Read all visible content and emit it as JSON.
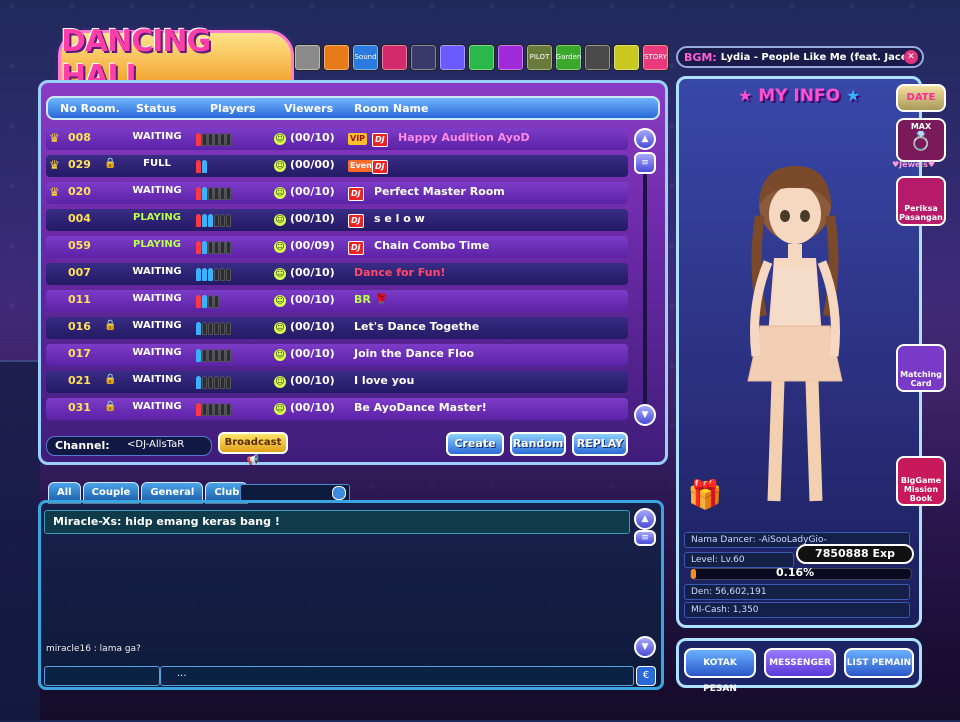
{
  "logo": {
    "text": "DANCING HALL"
  },
  "top_icons": [
    {
      "name": "card-icon",
      "label": "",
      "color": "#8a8a8a"
    },
    {
      "name": "shop-icon",
      "label": "",
      "color": "#e87a1a"
    },
    {
      "name": "sound-icon",
      "label": "Sound",
      "color": "#2a7ae0"
    },
    {
      "name": "bag-icon",
      "label": "",
      "color": "#d22a6a"
    },
    {
      "name": "ghost-icon",
      "label": "",
      "color": "#3a3a6a"
    },
    {
      "name": "world-icon",
      "label": "",
      "color": "#6a5aff"
    },
    {
      "name": "star-icon",
      "label": "",
      "color": "#2ab84a"
    },
    {
      "name": "gift-icon",
      "label": "",
      "color": "#a02ad8"
    },
    {
      "name": "pilot-icon",
      "label": "PILOT",
      "color": "#6a7a3a"
    },
    {
      "name": "garden-icon",
      "label": "Garden",
      "color": "#3aa82a"
    },
    {
      "name": "album-icon",
      "label": "",
      "color": "#4a4a4a"
    },
    {
      "name": "note-icon",
      "label": "",
      "color": "#c8c820"
    },
    {
      "name": "story-icon",
      "label": "STORY",
      "color": "#e83a7a"
    }
  ],
  "bgm": {
    "label": "BGM:",
    "song": "Lydia - People Like Me (feat. Jace)"
  },
  "room_list": {
    "headers": {
      "no": "No Room.",
      "status": "Status",
      "players": "Players",
      "viewers": "Viewers",
      "name": "Room Name"
    },
    "rows": [
      {
        "crown": "♛",
        "no": "008",
        "lock": "",
        "status": "WAITING",
        "st": "waiting",
        "players": "r,e,e,e,e,e",
        "viewers": "(00/10)",
        "badges": [
          "VIP",
          "DJ"
        ],
        "name": "Happy Audition AyoD",
        "name_color": "#ff8ae8"
      },
      {
        "crown": "♛",
        "no": "029",
        "lock": "🔒",
        "status": "FULL",
        "st": "full",
        "players": "r,bl",
        "viewers": "(00/00)",
        "badges": [
          "Event",
          "DJ"
        ],
        "name": "",
        "name_color": "#fff"
      },
      {
        "crown": "♛",
        "no": "020",
        "lock": "",
        "status": "WAITING",
        "st": "waiting",
        "players": "r,bl,e,e,e,e",
        "viewers": "(00/10)",
        "badges": [
          "DJ"
        ],
        "name": "Perfect Master Room",
        "name_color": "#ffffff"
      },
      {
        "crown": "",
        "no": "004",
        "lock": "",
        "status": "PLAYING",
        "st": "playing",
        "players": "r,bl,bl,e,e,e",
        "viewers": "(00/10)",
        "badges": [
          "DJ"
        ],
        "name": "s e l o w",
        "name_color": "#ffffff"
      },
      {
        "crown": "",
        "no": "059",
        "lock": "",
        "status": "PLAYING",
        "st": "playing",
        "players": "r,bl,e,e,e,e",
        "viewers": "(00/09)",
        "badges": [
          "DJ"
        ],
        "name": "Chain Combo Time",
        "name_color": "#ffffff"
      },
      {
        "crown": "",
        "no": "007",
        "lock": "",
        "status": "WAITING",
        "st": "waiting",
        "players": "bl,bl,bl,e,e,e",
        "viewers": "(00/10)",
        "badges": [],
        "name": "Dance for Fun!",
        "name_color": "#ff4a6a"
      },
      {
        "crown": "",
        "no": "011",
        "lock": "",
        "status": "WAITING",
        "st": "waiting",
        "players": "r,bl,e,e",
        "viewers": "(00/10)",
        "badges": [],
        "name": "BR 🌹",
        "name_color": "#b8ff4a"
      },
      {
        "crown": "",
        "no": "016",
        "lock": "🔒",
        "status": "WAITING",
        "st": "waiting",
        "players": "bl,e,e,e,e,e",
        "viewers": "(00/10)",
        "badges": [],
        "name": "Let's Dance Togethe",
        "name_color": "#ffffff"
      },
      {
        "crown": "",
        "no": "017",
        "lock": "",
        "status": "WAITING",
        "st": "waiting",
        "players": "bl,e,e,e,e,e",
        "viewers": "(00/10)",
        "badges": [],
        "name": "Join the Dance Floo",
        "name_color": "#ffffff"
      },
      {
        "crown": "",
        "no": "021",
        "lock": "🔒",
        "status": "WAITING",
        "st": "waiting",
        "players": "bl,e,e,e,e,e",
        "viewers": "(00/10)",
        "badges": [],
        "name": "I love you",
        "name_color": "#ffffff"
      },
      {
        "crown": "",
        "no": "031",
        "lock": "🔒",
        "status": "WAITING",
        "st": "waiting",
        "players": "r,e,e,e,e,e",
        "viewers": "(00/10)",
        "badges": [],
        "name": "Be AyoDance Master!",
        "name_color": "#ffffff"
      }
    ]
  },
  "channel": {
    "label": "Channel:",
    "value": "<DJ-AllsTaR"
  },
  "buttons": {
    "broadcast": "Broadcast",
    "create": "Create",
    "random": "Random",
    "replay": "REPLAY"
  },
  "chat": {
    "tabs": [
      "All",
      "Couple",
      "General",
      "Club"
    ],
    "line1": "Miracle-Xs: hidp emang keras bang !",
    "line2": "miracle16 : lama ga?",
    "input_text": "..."
  },
  "my_info": {
    "title": "MY INFO",
    "dancer_name": "Nama Dancer: -AiSooLadyGio-",
    "level": "Level: Lv.60",
    "exp": "7850888 Exp",
    "exp_pct_text": "0.16%",
    "exp_progress": 0.0016,
    "den": "Den: 56,602,191",
    "mcash": "MI-Cash: 1,350"
  },
  "side_buttons": {
    "date": "DATE",
    "max": "MAX",
    "jewels": "Jewels",
    "pasangan": "Periksa Pasangan",
    "matching": "Matching Card",
    "mission": "BigGame Mission Book"
  },
  "bottom_buttons": {
    "kotak": "KOTAK PESAN",
    "messenger": "MESSENGER",
    "list": "LIST PEMAIN"
  },
  "colors": {
    "accent": "#ff4fd2",
    "panel_border": "#9ad0ff",
    "playing": "#b8ff4a"
  }
}
